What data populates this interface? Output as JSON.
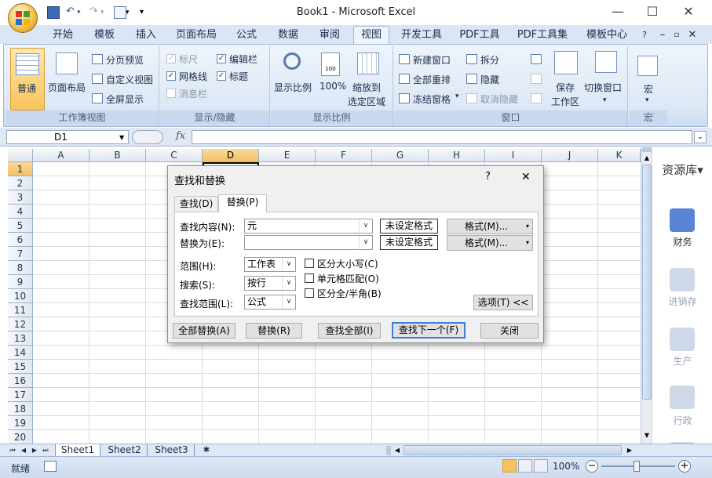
{
  "window": {
    "title": "Book1 - Microsoft Excel",
    "minimize": "—",
    "maximize": "☐",
    "close": "✕"
  },
  "tabs": [
    "开始",
    "模板",
    "插入",
    "页面布局",
    "公式",
    "数据",
    "审阅",
    "视图",
    "开发工具",
    "PDF工具",
    "PDF工具集",
    "模板中心"
  ],
  "active_tab": "视图",
  "ribbon": {
    "workbook_views": {
      "label": "工作簿视图",
      "normal": "普通",
      "page_layout": "页面布局",
      "page_break": "分页预览",
      "custom_views": "自定义视图",
      "full_screen": "全屏显示"
    },
    "show_hide": {
      "label": "显示/隐藏",
      "ruler": "标尺",
      "formula_bar": "编辑栏",
      "gridlines": "网格线",
      "headings": "标题",
      "message_bar": "消息栏"
    },
    "zoom": {
      "label": "显示比例",
      "zoom": "显示比例",
      "hundred": "100%",
      "zoom_sel_1": "缩放到",
      "zoom_sel_2": "选定区域"
    },
    "window": {
      "label": "窗口",
      "new_window": "新建窗口",
      "arrange_all": "全部重排",
      "freeze": "冻结窗格",
      "split": "拆分",
      "hide": "隐藏",
      "unhide": "取消隐藏",
      "save_ws_1": "保存",
      "save_ws_2": "工作区",
      "switch": "切换窗口"
    },
    "macros": {
      "label": "宏",
      "macro": "宏"
    }
  },
  "formula_bar": {
    "name_box": "D1",
    "fx": "fx",
    "value": ""
  },
  "columns": [
    "A",
    "B",
    "C",
    "D",
    "E",
    "F",
    "G",
    "H",
    "I",
    "J",
    "K"
  ],
  "selected_column": "D",
  "rows": [
    "1",
    "2",
    "3",
    "4",
    "5",
    "6",
    "7",
    "8",
    "9",
    "10",
    "11",
    "12",
    "13",
    "14",
    "15",
    "16",
    "17",
    "18",
    "19",
    "20"
  ],
  "selected_row": "1",
  "side_panel": {
    "title": "资源库",
    "items": [
      "财务",
      "进销存",
      "生产",
      "行政"
    ]
  },
  "sheets": [
    "Sheet1",
    "Sheet2",
    "Sheet3"
  ],
  "active_sheet": "Sheet1",
  "status": {
    "ready": "就绪",
    "zoom": "100%"
  },
  "dialog": {
    "title": "查找和替换",
    "help": "?",
    "close": "✕",
    "tab_find": "查找(D)",
    "tab_replace": "替换(P)",
    "find_label": "查找内容(N):",
    "find_value": "元",
    "replace_label": "替换为(E):",
    "replace_value": "",
    "no_format_1": "未设定格式",
    "no_format_2": "未设定格式",
    "format_btn_1": "格式(M)...",
    "format_btn_2": "格式(M)...",
    "within_label": "范围(H):",
    "within_value": "工作表",
    "search_label": "搜索(S):",
    "search_value": "按行",
    "lookin_label": "查找范围(L):",
    "lookin_value": "公式",
    "match_case": "区分大小写(C)",
    "match_cell": "单元格匹配(O)",
    "match_width": "区分全/半角(B)",
    "options_btn": "选项(T) <<",
    "replace_all": "全部替换(A)",
    "replace": "替换(R)",
    "find_all": "查找全部(I)",
    "find_next": "查找下一个(F)",
    "close_btn": "关闭"
  }
}
